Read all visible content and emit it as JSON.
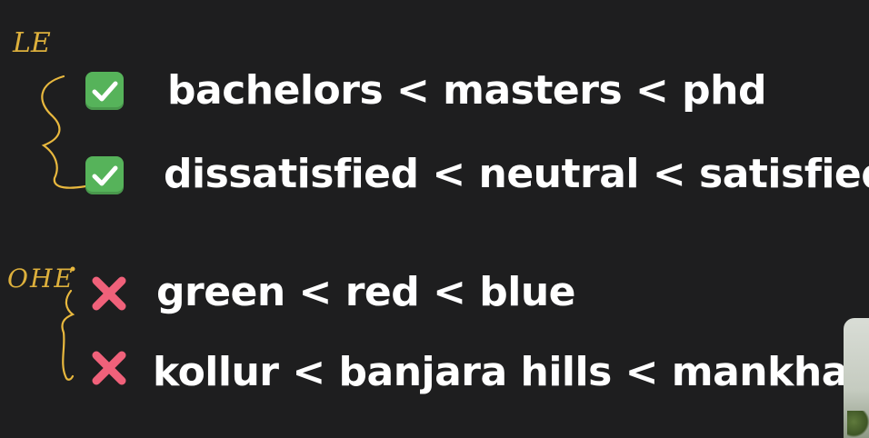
{
  "annotations": {
    "group1_label": "LE",
    "group2_label": "OHE"
  },
  "lines": [
    {
      "icon": "check-mark-icon",
      "text": "bachelors < masters < phd"
    },
    {
      "icon": "check-mark-icon",
      "text": "dissatisfied < neutral < satisfied"
    },
    {
      "icon": "cross-mark-icon",
      "text": "green < red < blue"
    },
    {
      "icon": "cross-mark-icon",
      "text": "kollur < banjara hills < mankhal"
    }
  ],
  "colors": {
    "background": "#1e1e1f",
    "text": "#ffffff",
    "check_green": "#56b35a",
    "cross_red": "#f0617a",
    "annotation_ink": "#e8b83e"
  }
}
